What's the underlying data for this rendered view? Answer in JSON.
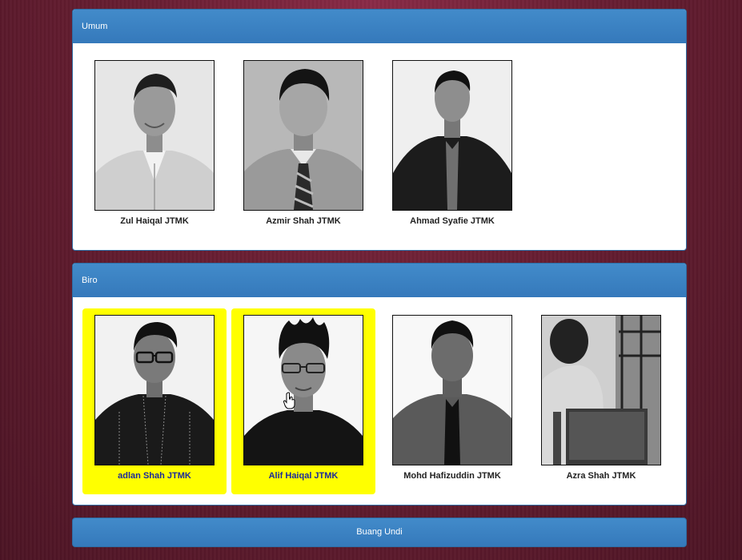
{
  "panels": {
    "umum": {
      "title": "Umum",
      "candidates": [
        {
          "name": "Zul Haiqal JTMK",
          "selected": false
        },
        {
          "name": "Azmir Shah JTMK",
          "selected": false
        },
        {
          "name": "Ahmad Syafie JTMK",
          "selected": false
        }
      ]
    },
    "biro": {
      "title": "Biro",
      "candidates": [
        {
          "name": "adlan Shah JTMK",
          "selected": true
        },
        {
          "name": "Alif Haiqal JTMK",
          "selected": true
        },
        {
          "name": "Mohd Hafizuddin JTMK",
          "selected": false
        },
        {
          "name": "Azra Shah JTMK",
          "selected": false
        }
      ]
    }
  },
  "actions": {
    "vote_label": "Buang Undi"
  },
  "colors": {
    "panel_heading": "#428bca",
    "selected_highlight": "#ffff00",
    "page_background": "#6a1f33"
  },
  "icons": {
    "cursor": "hand-pointer-icon"
  }
}
